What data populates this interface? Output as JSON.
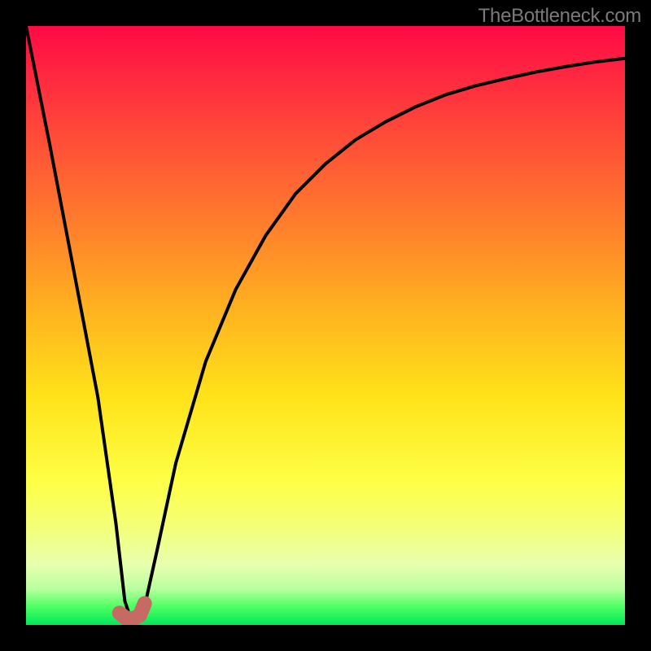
{
  "watermark": "TheBottleneck.com",
  "chart_data": {
    "type": "line",
    "title": "",
    "xlabel": "",
    "ylabel": "",
    "xlim": [
      0,
      100
    ],
    "ylim": [
      0,
      100
    ],
    "series": [
      {
        "name": "bottleneck-curve",
        "x": [
          0,
          4,
          8,
          12,
          15,
          16.5,
          17.5,
          18.5,
          20,
          22,
          25,
          30,
          35,
          40,
          45,
          50,
          55,
          60,
          65,
          70,
          75,
          80,
          85,
          90,
          95,
          100
        ],
        "y": [
          100,
          80,
          59,
          38,
          17,
          4,
          1,
          1,
          4,
          13,
          27,
          44,
          56,
          65,
          72,
          77,
          81,
          84,
          86.5,
          88.5,
          90,
          91.2,
          92.3,
          93.2,
          94,
          94.6
        ]
      }
    ],
    "marker": {
      "name": "optimal-point",
      "color": "#c66a63",
      "points_xy": [
        [
          15.6,
          2.0
        ],
        [
          16.6,
          1.2
        ],
        [
          17.8,
          1.0
        ],
        [
          19.0,
          1.6
        ],
        [
          19.8,
          3.6
        ]
      ],
      "stroke_width_px": 18
    },
    "background_gradient": {
      "top": "#ff0a45",
      "mid": "#ffe31a",
      "bottom": "#00e85a"
    }
  }
}
